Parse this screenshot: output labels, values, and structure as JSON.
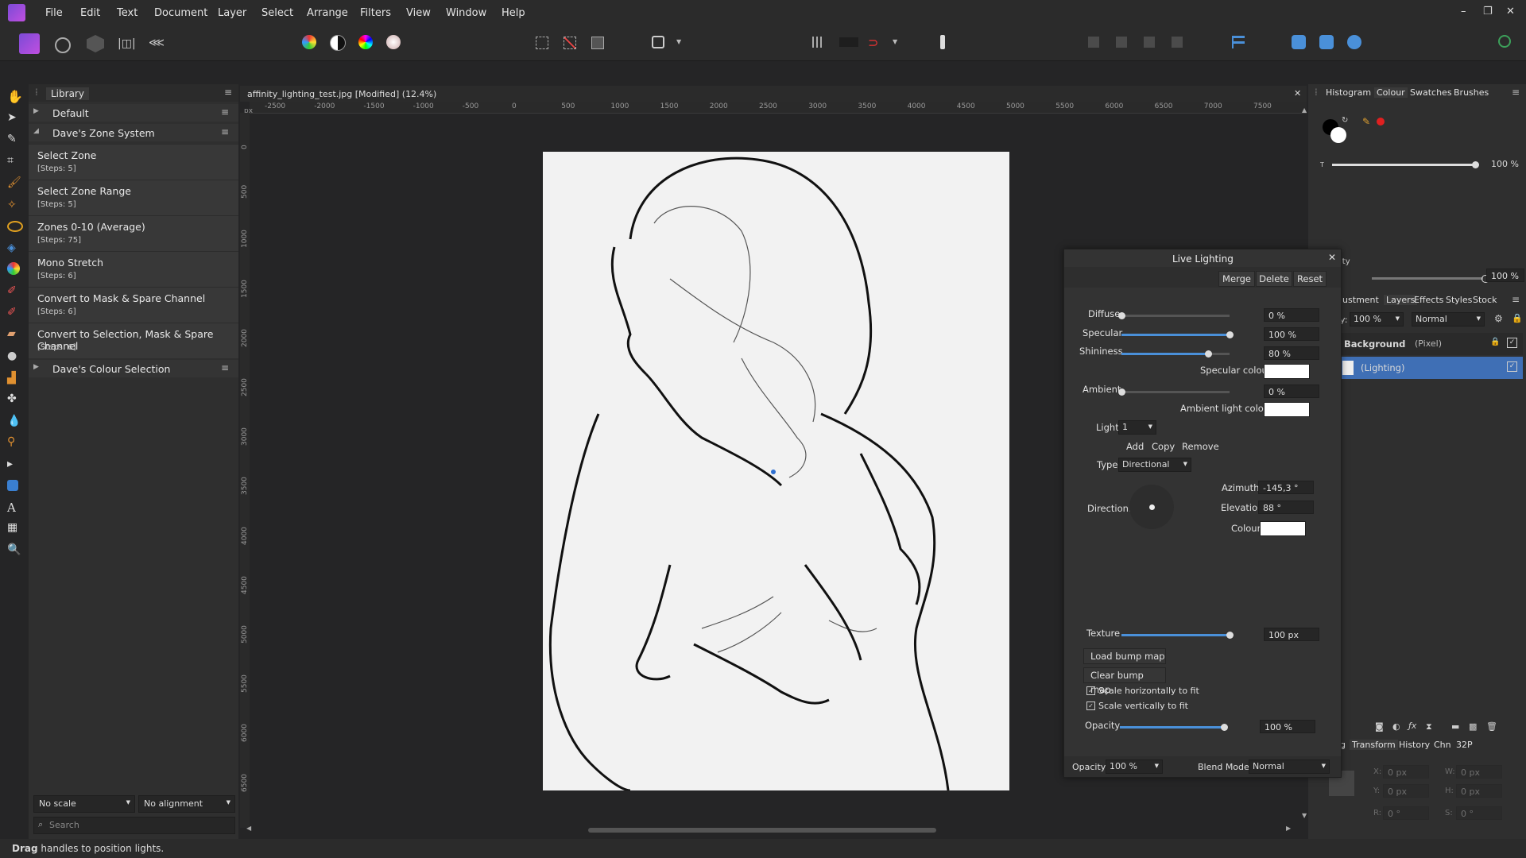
{
  "menu": [
    "File",
    "Edit",
    "Text",
    "Document",
    "Layer",
    "Select",
    "Arrange",
    "Filters",
    "View",
    "Window",
    "Help"
  ],
  "library": {
    "tab": "Library",
    "groups": [
      {
        "name": "Default",
        "collapsed": true
      },
      {
        "name": "Dave's Zone System",
        "collapsed": false
      },
      {
        "name": "Dave's Colour Selection",
        "collapsed": true
      }
    ],
    "items": [
      {
        "title": "Select Zone",
        "steps": "[Steps: 5]"
      },
      {
        "title": "Select Zone Range",
        "steps": "[Steps: 5]"
      },
      {
        "title": "Zones 0-10 (Average)",
        "steps": "[Steps: 75]"
      },
      {
        "title": "Mono Stretch",
        "steps": "[Steps: 6]"
      },
      {
        "title": "Convert to Mask & Spare Channel",
        "steps": "[Steps: 6]"
      },
      {
        "title": "Convert to Selection, Mask & Spare Channel",
        "steps": "[Steps: 6]"
      }
    ],
    "scale": "No scale",
    "alignment": "No alignment",
    "search_placeholder": "Search"
  },
  "document": {
    "tab_title": "affinity_lighting_test.jpg [Modified] (12.4%)",
    "ruler_top": [
      "-2500",
      "-2000",
      "-1500",
      "-1000",
      "-500",
      "0",
      "500",
      "1000",
      "1500",
      "2000",
      "2500",
      "3000",
      "3500",
      "4000",
      "4500",
      "5000",
      "5500",
      "6000",
      "6500",
      "7000",
      "7500"
    ],
    "ruler_unit": "px",
    "ruler_left": [
      "0",
      "500",
      "1000",
      "1500",
      "2000",
      "2500",
      "3000",
      "3500",
      "4000",
      "4500",
      "5000",
      "5500",
      "6000",
      "6500"
    ]
  },
  "right_panel": {
    "top_tabs": [
      "Histogram",
      "Colour",
      "Swatches",
      "Brushes"
    ],
    "active_top_tab": "Colour",
    "t_label": "T",
    "t_value": "100 %",
    "opacity_label": "ity",
    "opacity_value": "100 %",
    "layer_tabs": [
      "justment",
      "Layers",
      "Effects",
      "Styles",
      "Stock"
    ],
    "layer_opacity_label": "y:",
    "layer_opacity": "100 %",
    "blend_mode": "Normal",
    "layers": [
      {
        "name": "Background",
        "kind": "(Pixel)"
      },
      {
        "name": "(Lighting)",
        "kind": ""
      }
    ],
    "bottom_tabs": [
      "g",
      "Transform",
      "History",
      "Chn",
      "32P"
    ],
    "transform": {
      "x": "0 px",
      "y": "0 px",
      "w": "0 px",
      "h": "0 px",
      "r": "0 °",
      "s": "0 °"
    },
    "transform_labels": {
      "x": "X:",
      "y": "Y:",
      "w": "W:",
      "h": "H:",
      "r": "R:",
      "s": "S:"
    }
  },
  "live_lighting": {
    "title": "Live Lighting",
    "buttons": [
      "Merge",
      "Delete",
      "Reset"
    ],
    "diffuse": {
      "label": "Diffuse",
      "value": "0 %",
      "level": 0
    },
    "specular": {
      "label": "Specular",
      "value": "100 %",
      "level": 1.0
    },
    "shininess": {
      "label": "Shininess",
      "value": "80 %",
      "level": 0.8
    },
    "specular_colour_label": "Specular colour",
    "ambient": {
      "label": "Ambient",
      "value": "0 %",
      "level": 0
    },
    "ambient_colour_label": "Ambient light colour",
    "light_label": "Light",
    "light_value": "1",
    "light_buttons": [
      "Add",
      "Copy",
      "Remove"
    ],
    "type_label": "Type",
    "type_value": "Directional",
    "direction_label": "Direction:",
    "azimuth_label": "Azimuth",
    "azimuth_value": "-145,3 °",
    "elevation_label": "Elevation",
    "elevation_value": "88 °",
    "colour_label": "Colour",
    "texture": {
      "label": "Texture",
      "value": "100 px",
      "level": 1.0
    },
    "load_bump": "Load bump map",
    "clear_bump": "Clear bump map",
    "scale_h": "Scale horizontally to fit",
    "scale_v": "Scale vertically to fit",
    "opacity": {
      "label": "Opacity",
      "value": "100 %",
      "level": 1.0
    },
    "footer_opacity_label": "Opacity:",
    "footer_opacity": "100 %",
    "footer_blend_label": "Blend Mode:",
    "footer_blend": "Normal"
  },
  "status": {
    "bold": "Drag",
    "text": " handles to position lights."
  },
  "colors": {
    "accent": "#4a90d9",
    "layer_selected": "#3f6fb5",
    "fg_swatch": "#000000",
    "bg_swatch": "#ffffff",
    "red_dot": "#e02020"
  }
}
